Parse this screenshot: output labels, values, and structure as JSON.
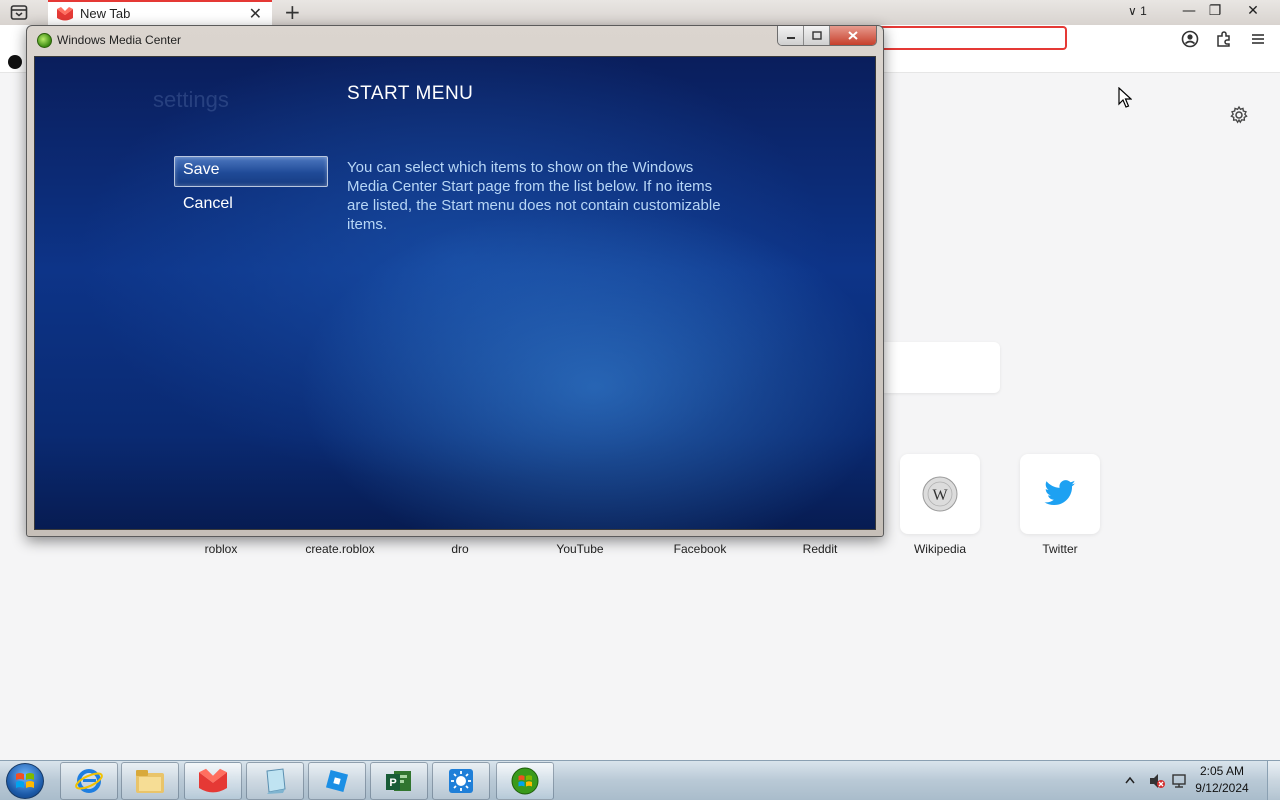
{
  "browser": {
    "tab": {
      "title": "New Tab",
      "close": "✕"
    },
    "new_tab": "+",
    "tab_counter": "1",
    "window_controls": {
      "minimize": "—",
      "restore": "❐",
      "close": "✕"
    }
  },
  "shortcuts": [
    {
      "label": "roblox"
    },
    {
      "label": "create.roblox"
    },
    {
      "label": "dro"
    },
    {
      "label": "YouTube"
    },
    {
      "label": "Facebook"
    },
    {
      "label": "Reddit"
    },
    {
      "label": "Wikipedia",
      "icon": "wikipedia-icon"
    },
    {
      "label": "Twitter",
      "icon": "twitter-icon",
      "color": "#1da1f2"
    }
  ],
  "wmc": {
    "window_title": "Windows Media Center",
    "watermark": "settings",
    "heading": "START MENU",
    "save_label": "Save",
    "cancel_label": "Cancel",
    "description": "You can select which items to show on the Windows Media Center Start page from the list below. If no items are listed, the Start menu does not contain customizable items."
  },
  "taskbar": {
    "pinned": [
      "internet-explorer-icon",
      "file-explorer-icon",
      "browser-icon",
      "notepad-icon",
      "roblox-studio-icon",
      "project-icon",
      "weather-icon",
      "media-center-icon"
    ],
    "clock": {
      "time": "2:05 AM",
      "date": "9/12/2024"
    }
  },
  "colors": {
    "accent_red": "#e53935",
    "wmc_blue": "#0d3488",
    "twitter_blue": "#1da1f2"
  }
}
